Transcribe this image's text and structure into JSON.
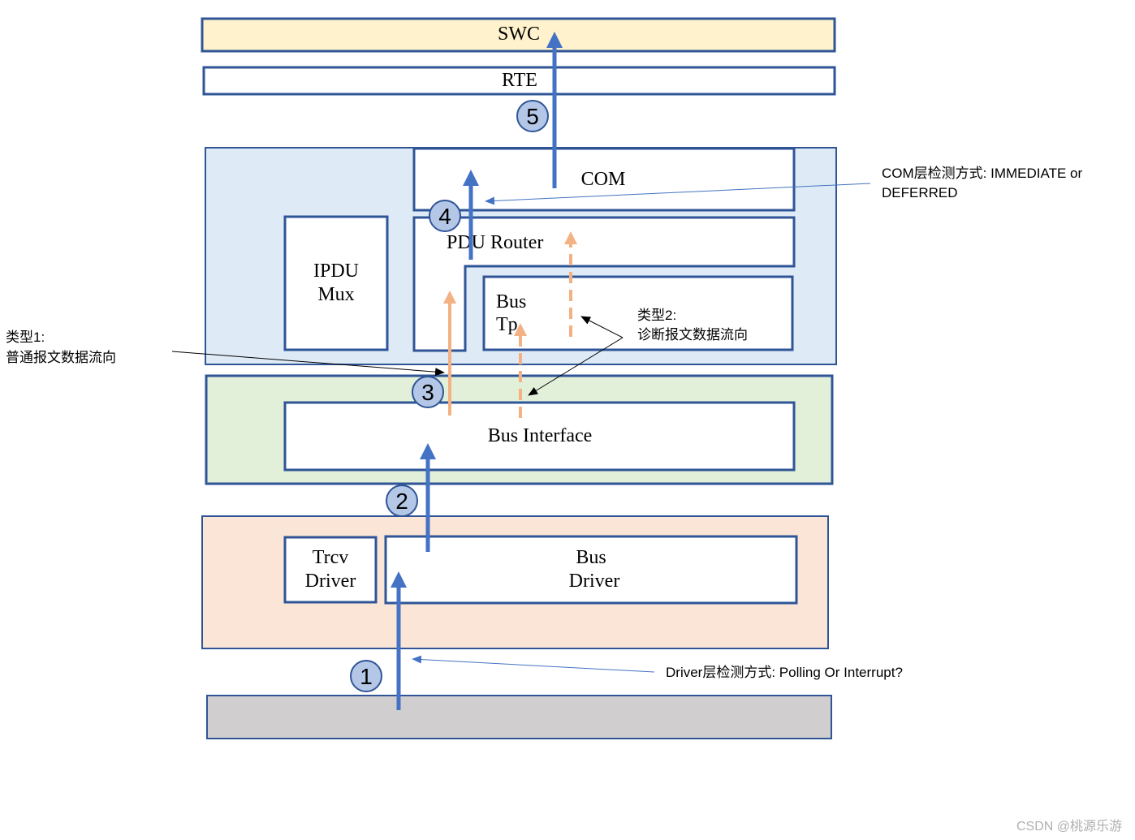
{
  "colors": {
    "border": "#2F5597",
    "flow_blue": "#4472C4",
    "flow_orange": "#F4B183",
    "step_circle": "#B4C7E7",
    "swc_fill": "#FFF2CC",
    "service_fill": "#DEEBF7",
    "interface_fill": "#E2F0D9",
    "driver_fill": "#FBE5D6",
    "hardware_fill": "#D0CECE"
  },
  "layers": {
    "swc": "SWC",
    "rte": "RTE",
    "com": "COM",
    "pdu_router": "PDU Router",
    "ipdu_mux_1": "IPDU",
    "ipdu_mux_2": "Mux",
    "bus_tp_1": "Bus",
    "bus_tp_2": "Tp",
    "bus_interface": "Bus Interface",
    "trcv_driver_1": "Trcv",
    "trcv_driver_2": "Driver",
    "bus_driver_1": "Bus",
    "bus_driver_2": "Driver"
  },
  "steps": [
    "1",
    "2",
    "3",
    "4",
    "5"
  ],
  "annotations": {
    "com_detect_1": "COM层检测方式:   IMMEDIATE or",
    "com_detect_2": "DEFERRED",
    "driver_detect": "Driver层检测方式:  Polling  Or Interrupt?",
    "type1_1": "类型1:",
    "type1_2": "普通报文数据流向",
    "type2_1": "类型2:",
    "type2_2": "诊断报文数据流向"
  },
  "watermark": "CSDN @桃源乐游"
}
